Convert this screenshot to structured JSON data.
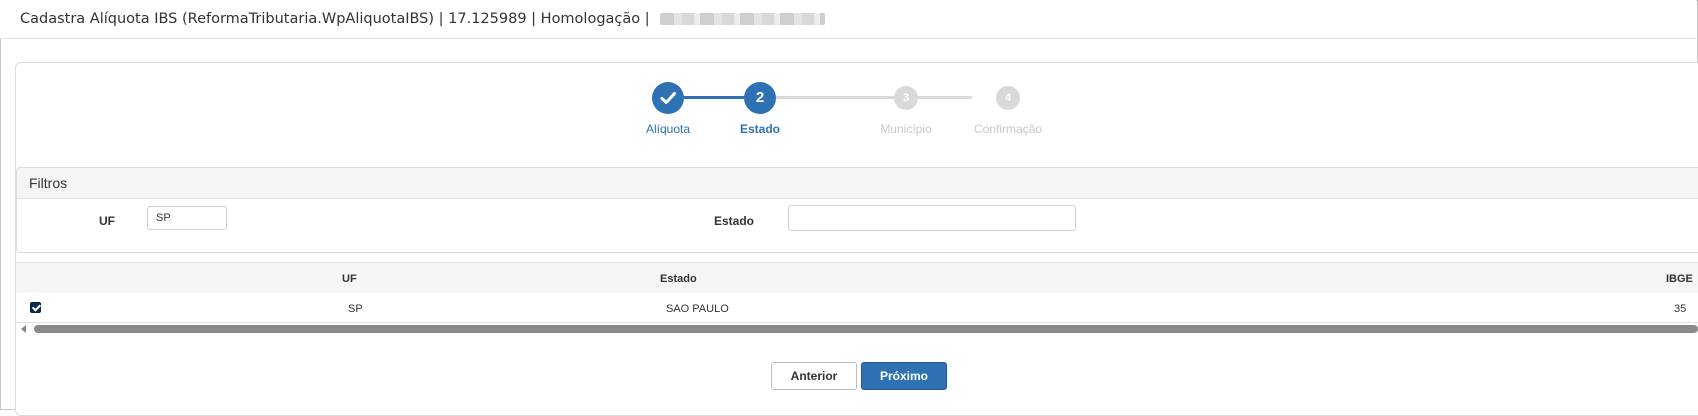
{
  "header": {
    "title": "Cadastra Alíquota IBS (ReformaTributaria.WpAliquotaIBS) | 17.125989 | Homologação |",
    "redacted_suffix": "Ĝ"
  },
  "stepper": {
    "steps": [
      {
        "number": "",
        "label": "Alíquota",
        "state": "done"
      },
      {
        "number": "2",
        "label": "Estado",
        "state": "active"
      },
      {
        "number": "3",
        "label": "Município",
        "state": "pending"
      },
      {
        "number": "4",
        "label": "Confirmação",
        "state": "pending"
      }
    ]
  },
  "filters": {
    "title": "Filtros",
    "uf_label": "UF",
    "uf_value": "SP",
    "estado_label": "Estado",
    "estado_value": ""
  },
  "grid": {
    "columns": [
      "UF",
      "Estado",
      "IBGE"
    ],
    "rows": [
      {
        "checked": true,
        "uf": "SP",
        "estado": "SAO PAULO",
        "ibge": "35"
      }
    ]
  },
  "actions": {
    "prev_label": "Anterior",
    "next_label": "Próximo"
  },
  "colors": {
    "primary": "#2f72b3",
    "pending": "#d9d9d9",
    "checkbox": "#0d2a4c"
  }
}
